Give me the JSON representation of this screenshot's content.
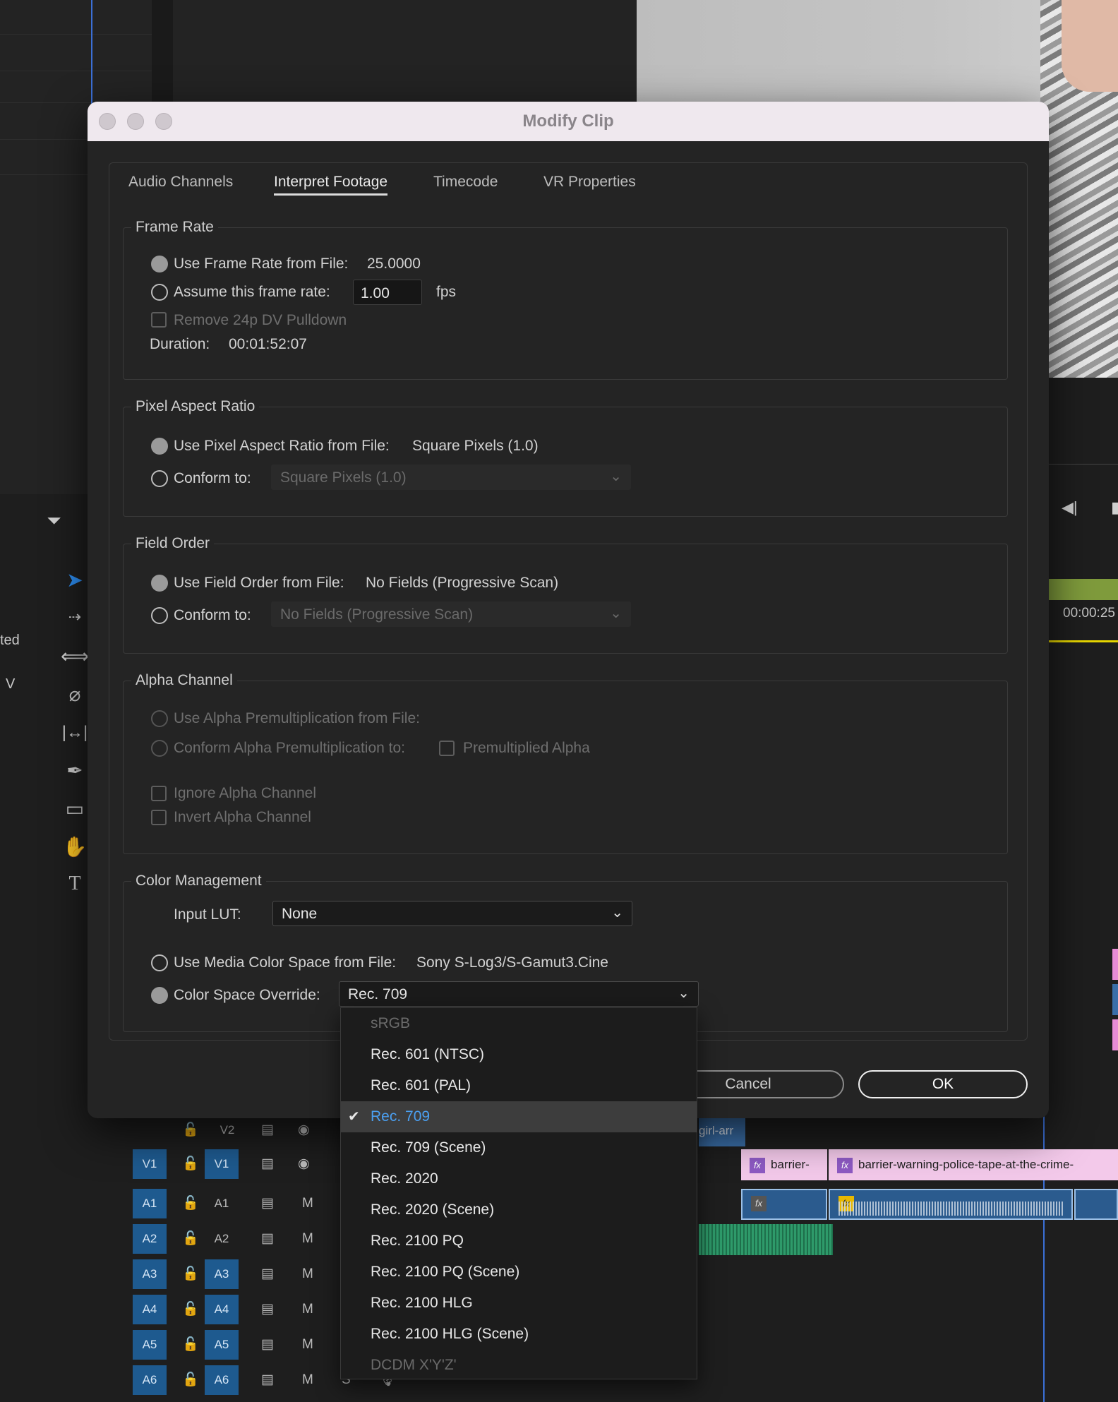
{
  "dialog": {
    "title": "Modify Clip",
    "tabs": [
      "Audio Channels",
      "Interpret Footage",
      "Timecode",
      "VR Properties"
    ],
    "frame_rate": {
      "title": "Frame Rate",
      "use_from_file_label": "Use Frame Rate from File:",
      "use_from_file_value": "25.0000",
      "assume_label": "Assume this frame rate:",
      "assume_value": "1.00",
      "assume_unit": "fps",
      "remove_pulldown_label": "Remove 24p DV Pulldown",
      "duration_label": "Duration:",
      "duration_value": "00:01:52:07"
    },
    "pixel_aspect": {
      "title": "Pixel Aspect Ratio",
      "use_from_file_label": "Use Pixel Aspect Ratio from File:",
      "use_from_file_value": "Square Pixels (1.0)",
      "conform_label": "Conform to:",
      "conform_value": "Square Pixels (1.0)"
    },
    "field_order": {
      "title": "Field Order",
      "use_from_file_label": "Use Field Order from File:",
      "use_from_file_value": "No Fields (Progressive Scan)",
      "conform_label": "Conform to:",
      "conform_value": "No Fields (Progressive Scan)"
    },
    "alpha": {
      "title": "Alpha Channel",
      "use_premult_label": "Use Alpha Premultiplication from File:",
      "conform_premult_label": "Conform Alpha Premultiplication to:",
      "premultiplied_label": "Premultiplied Alpha",
      "ignore_label": "Ignore Alpha Channel",
      "invert_label": "Invert Alpha Channel"
    },
    "color": {
      "title": "Color Management",
      "input_lut_label": "Input LUT:",
      "input_lut_value": "None",
      "use_media_label": "Use Media Color Space from File:",
      "use_media_value": "Sony S-Log3/S-Gamut3.Cine",
      "override_label": "Color Space Override:",
      "override_value": "Rec. 709"
    },
    "buttons": {
      "cancel": "Cancel",
      "ok": "OK"
    }
  },
  "color_space_menu": {
    "items": [
      {
        "label": "sRGB",
        "disabled": true
      },
      {
        "label": "Rec. 601 (NTSC)"
      },
      {
        "label": "Rec. 601 (PAL)"
      },
      {
        "label": "Rec. 709",
        "selected": true
      },
      {
        "label": "Rec. 709 (Scene)"
      },
      {
        "label": "Rec. 2020"
      },
      {
        "label": "Rec. 2020 (Scene)"
      },
      {
        "label": "Rec. 2100 PQ"
      },
      {
        "label": "Rec. 2100 PQ (Scene)"
      },
      {
        "label": "Rec. 2100 HLG"
      },
      {
        "label": "Rec. 2100 HLG (Scene)"
      },
      {
        "label": "DCDM X'Y'Z'",
        "disabled": true
      }
    ],
    "check_glyph": "✔"
  },
  "background": {
    "timecode": "00:00:25",
    "left_text_1": "ted",
    "left_text_2": "V",
    "tracks": [
      {
        "src": "",
        "dst": "V2",
        "toggle": "eye"
      },
      {
        "src": "V1",
        "dst": "V1",
        "toggle": "eye"
      },
      {
        "src": "A1",
        "dst": "A1",
        "toggle": "M"
      },
      {
        "src": "A2",
        "dst": "A2",
        "toggle": "M"
      },
      {
        "src": "A3",
        "dst": "A3",
        "toggle": "M"
      },
      {
        "src": "A4",
        "dst": "A4",
        "toggle": "M"
      },
      {
        "src": "A5",
        "dst": "A5",
        "toggle": "M"
      },
      {
        "src": "A6",
        "dst": "A6",
        "toggle": "M"
      }
    ],
    "solo_label": "S",
    "clip_v2_label": "girl-arr",
    "clip_v1_short": "barrier-",
    "clip_v1_long": "barrier-warning-police-tape-at-the-crime-",
    "fx_label": "fx"
  }
}
